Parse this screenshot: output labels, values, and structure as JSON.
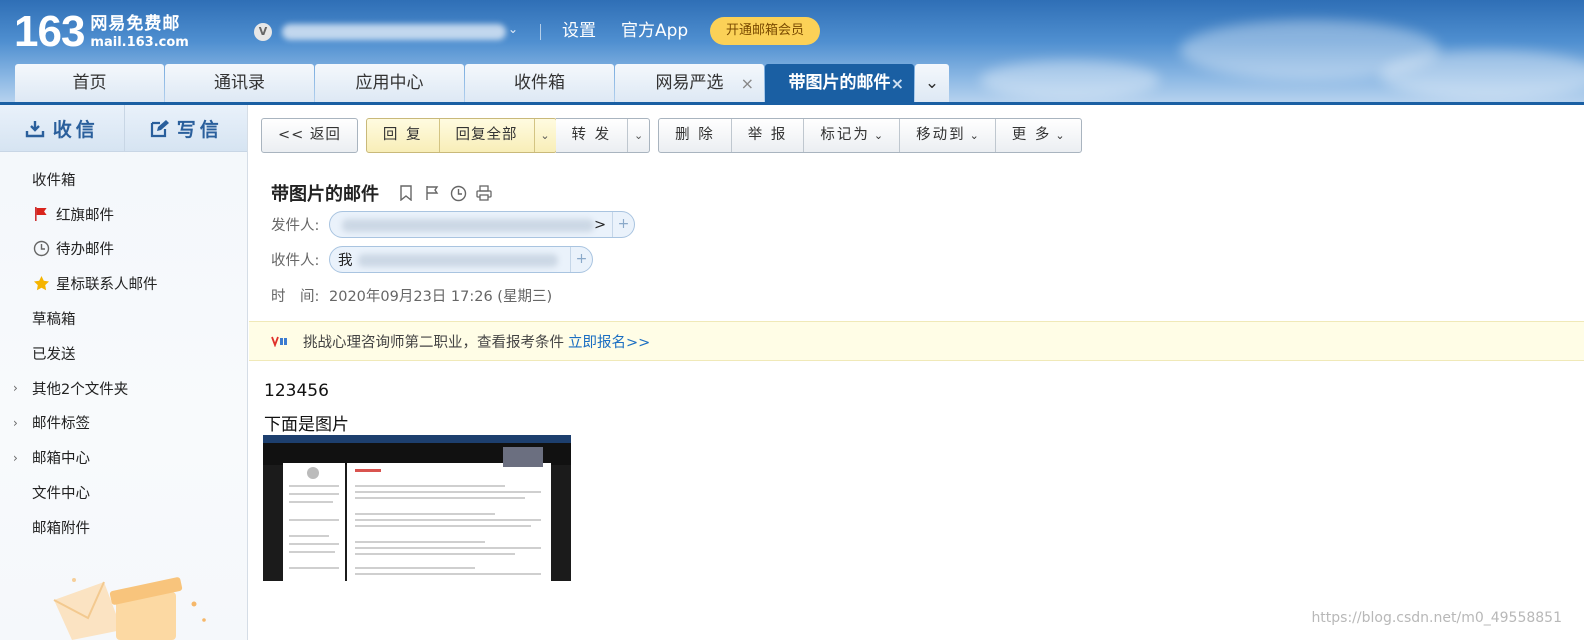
{
  "header": {
    "logo_number": "163",
    "logo_cn": "网易免费邮",
    "logo_en": "mail.163.com",
    "user_badge": "V",
    "links": {
      "settings": "设置",
      "app": "官方App"
    },
    "vip_button": "开通邮箱会员",
    "tabs": [
      {
        "label": "首页",
        "closable": false,
        "active": false
      },
      {
        "label": "通讯录",
        "closable": false,
        "active": false
      },
      {
        "label": "应用中心",
        "closable": false,
        "active": false
      },
      {
        "label": "收件箱",
        "closable": false,
        "active": false
      },
      {
        "label": "网易严选",
        "closable": true,
        "active": false
      },
      {
        "label": "带图片的邮件",
        "closable": true,
        "active": true
      }
    ],
    "close_glyph": "×",
    "more_glyph": "⌄"
  },
  "sidebar": {
    "receive": "收信",
    "compose": "写信",
    "folders": [
      {
        "label": "收件箱",
        "icon": "",
        "expandable": false
      },
      {
        "label": "红旗邮件",
        "icon": "red-flag-icon",
        "expandable": false
      },
      {
        "label": "待办邮件",
        "icon": "clock-icon",
        "expandable": false
      },
      {
        "label": "星标联系人邮件",
        "icon": "star-icon",
        "expandable": false
      },
      {
        "label": "草稿箱",
        "icon": "",
        "expandable": false
      },
      {
        "label": "已发送",
        "icon": "",
        "expandable": false
      },
      {
        "label": "其他2个文件夹",
        "icon": "",
        "expandable": true
      },
      {
        "label": "邮件标签",
        "icon": "",
        "expandable": true
      },
      {
        "label": "邮箱中心",
        "icon": "",
        "expandable": true
      },
      {
        "label": "文件中心",
        "icon": "",
        "expandable": false
      },
      {
        "label": "邮箱附件",
        "icon": "",
        "expandable": false
      }
    ]
  },
  "toolbar": {
    "back": "<< 返回",
    "reply": "回 复",
    "reply_all": "回复全部",
    "forward": "转 发",
    "delete": "删 除",
    "report": "举 报",
    "mark_as": "标记为",
    "move_to": "移动到",
    "more": "更 多"
  },
  "mail": {
    "subject": "带图片的邮件",
    "from_label": "发件人:",
    "from_value_end": ">",
    "to_label": "收件人:",
    "to_value_start": "我",
    "time_label": "时　间:",
    "time_value": "2020年09月23日 17:26 (星期三)",
    "body_lines": [
      "123456",
      "下面是图片"
    ]
  },
  "ad": {
    "logo": "V.RE",
    "text": "挑战心理咨询师第二职业，查看报考条件",
    "link": "立即报名>>"
  },
  "watermark": "https://blog.csdn.net/m0_49558851",
  "colors": {
    "header_blue": "#1a5fa3",
    "vip_yellow": "#fbd157",
    "link_blue": "#1b6ec2",
    "ad_bg": "#fffde6"
  }
}
